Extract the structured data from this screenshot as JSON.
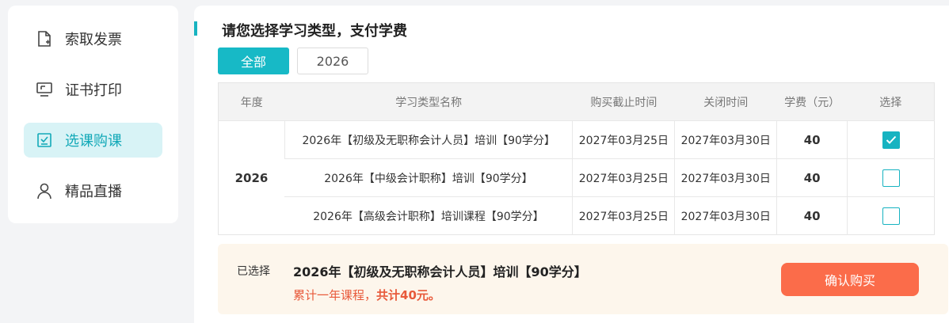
{
  "sidebar": {
    "items": [
      {
        "label": "索取发票",
        "icon": "invoice-icon",
        "active": false
      },
      {
        "label": "证书打印",
        "icon": "certificate-print-icon",
        "active": false
      },
      {
        "label": "选课购课",
        "icon": "course-select-icon",
        "active": true
      },
      {
        "label": "精品直播",
        "icon": "user-icon",
        "active": false
      }
    ]
  },
  "main": {
    "title": "请您选择学习类型，支付学费",
    "tabs": [
      {
        "label": "全部",
        "active": true
      },
      {
        "label": "2026",
        "active": false
      }
    ],
    "table": {
      "headers": [
        "年度",
        "学习类型名称",
        "购买截止时间",
        "关闭时间",
        "学费（元）",
        "选择"
      ],
      "year": "2026",
      "rows": [
        {
          "name": "2026年【初级及无职称会计人员】培训【90学分】",
          "deadline": "2027年03月25日",
          "close": "2027年03月30日",
          "fee": "40",
          "selected": true
        },
        {
          "name": "2026年【中级会计职称】培训【90学分】",
          "deadline": "2027年03月25日",
          "close": "2027年03月30日",
          "fee": "40",
          "selected": false
        },
        {
          "name": "2026年【高级会计职称】培训课程【90学分】",
          "deadline": "2027年03月25日",
          "close": "2027年03月30日",
          "fee": "40",
          "selected": false
        }
      ]
    },
    "summary": {
      "label": "已选择",
      "course": "2026年【初级及无职称会计人员】培训【90学分】",
      "note_prefix": "累计一年课程，",
      "note_total": "共计40元。",
      "confirm_label": "确认购买"
    }
  },
  "colors": {
    "accent": "#17b3c1",
    "price": "#e8593a",
    "confirm": "#fb6c4a"
  }
}
